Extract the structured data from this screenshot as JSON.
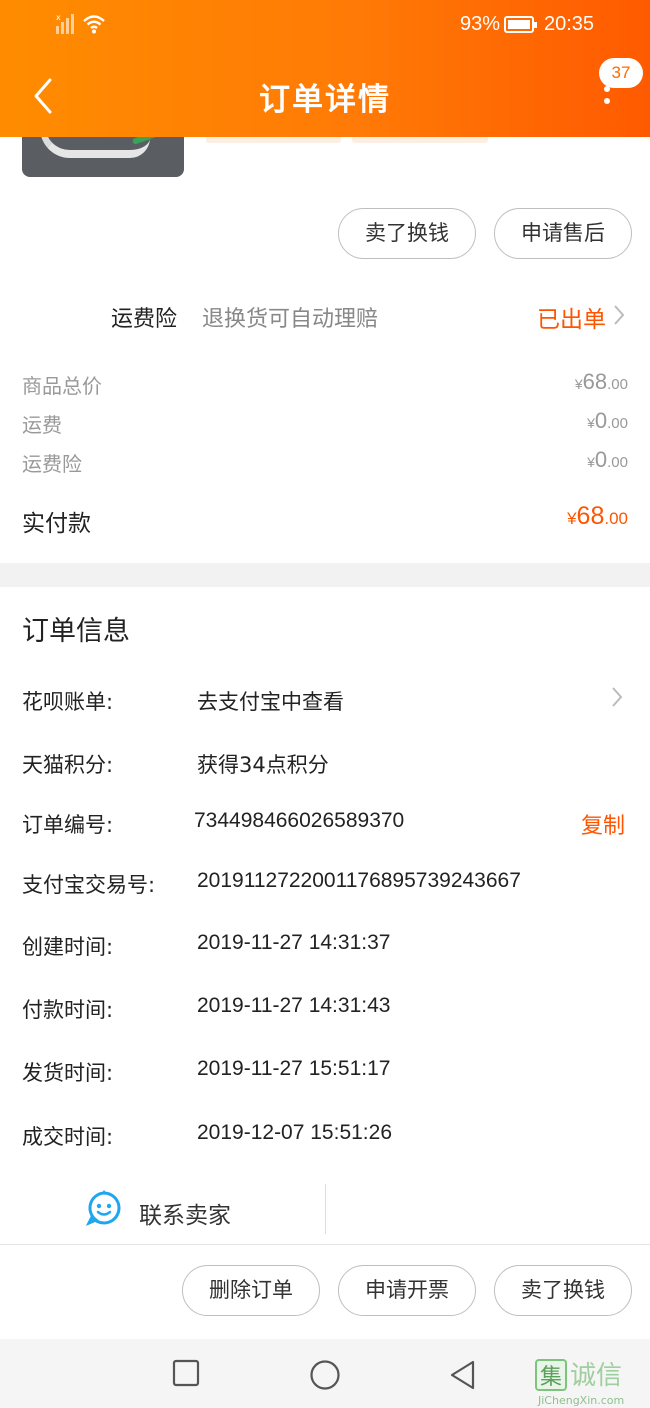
{
  "status_bar": {
    "battery": "93%",
    "time": "20:35"
  },
  "nav": {
    "title": "订单详情",
    "badge": "37"
  },
  "actions": {
    "sell": "卖了换钱",
    "after_sale": "申请售后"
  },
  "insurance": {
    "label": "运费险",
    "desc": "退换货可自动理赔",
    "status": "已出单"
  },
  "prices": {
    "goods_total": {
      "label": "商品总价",
      "currency": "¥",
      "int": "68",
      "dec": ".00"
    },
    "shipping": {
      "label": "运费",
      "currency": "¥",
      "int": "0",
      "dec": ".00"
    },
    "shipping_ins": {
      "label": "运费险",
      "currency": "¥",
      "int": "0",
      "dec": ".00"
    },
    "paid": {
      "label": "实付款",
      "currency": "¥",
      "int": "68",
      "dec": ".00"
    }
  },
  "order_info": {
    "title": "订单信息",
    "huabei": {
      "label": "花呗账单:",
      "value": "去支付宝中查看"
    },
    "points": {
      "label": "天猫积分:",
      "value": "获得34点积分"
    },
    "order_no": {
      "label": "订单编号:",
      "value": "734498466026589370",
      "copy": "复制"
    },
    "alipay_no": {
      "label": "支付宝交易号:",
      "value": "2019112722001176895739243667"
    },
    "created": {
      "label": "创建时间:",
      "value": "2019-11-27 14:31:37"
    },
    "paid_time": {
      "label": "付款时间:",
      "value": "2019-11-27 14:31:43"
    },
    "shipped": {
      "label": "发货时间:",
      "value": "2019-11-27 15:51:17"
    },
    "completed": {
      "label": "成交时间:",
      "value": "2019-12-07 15:51:26"
    }
  },
  "contact": {
    "label": "联系卖家"
  },
  "footer": {
    "delete": "删除订单",
    "invoice": "申请开票",
    "sell": "卖了换钱"
  },
  "colors": {
    "accent": "#ff5500",
    "header_start": "#ff8c00",
    "header_end": "#ff5a00",
    "contact_blue": "#1ea7f0"
  }
}
